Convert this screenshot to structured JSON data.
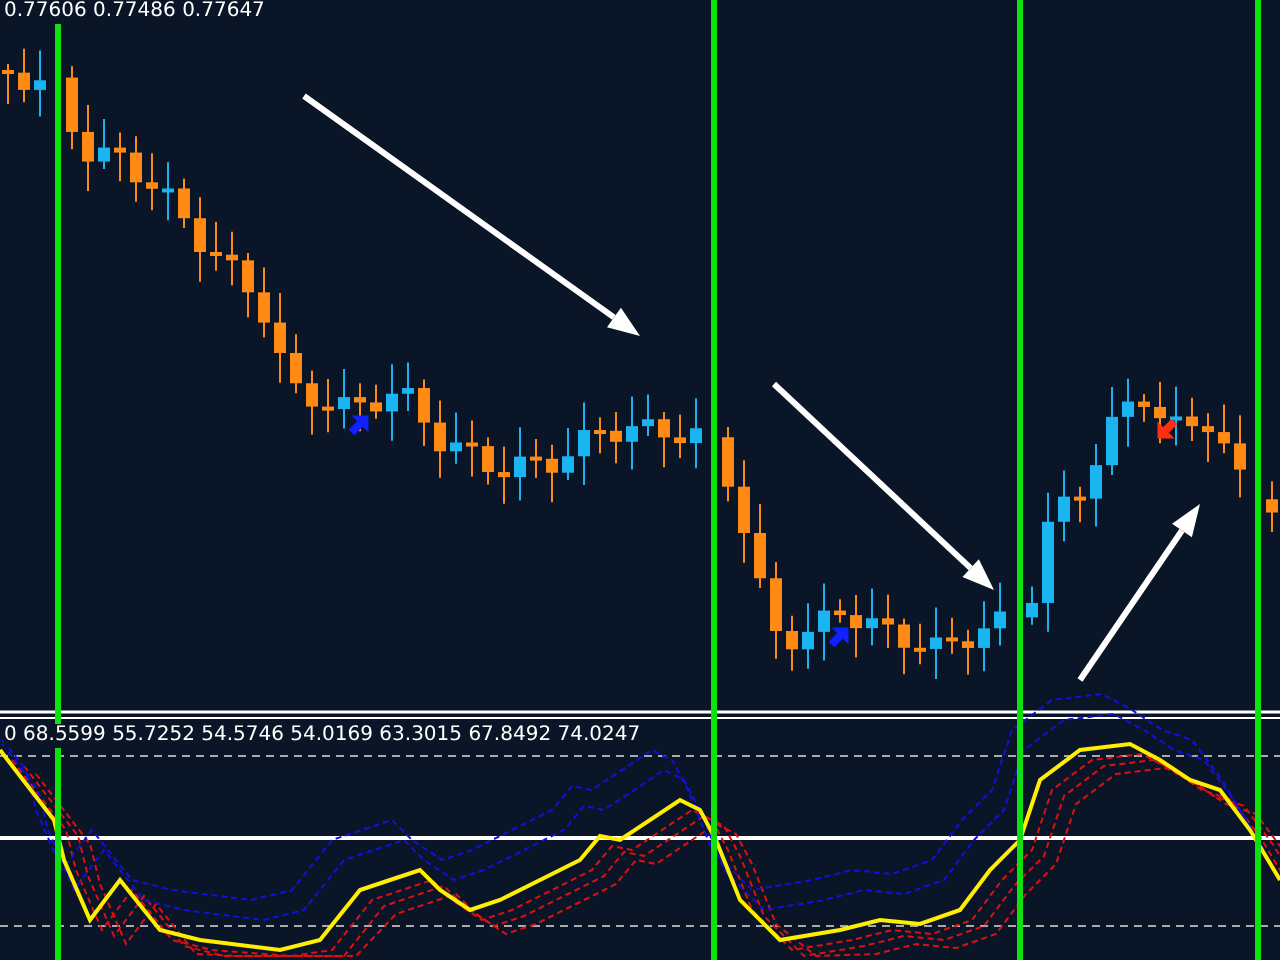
{
  "price_readout": "0.77606 0.77486 0.77647",
  "indicator_readout": "0 68.5599 55.7252 54.5746 54.0169 63.3015 67.8492 74.0247"
}
